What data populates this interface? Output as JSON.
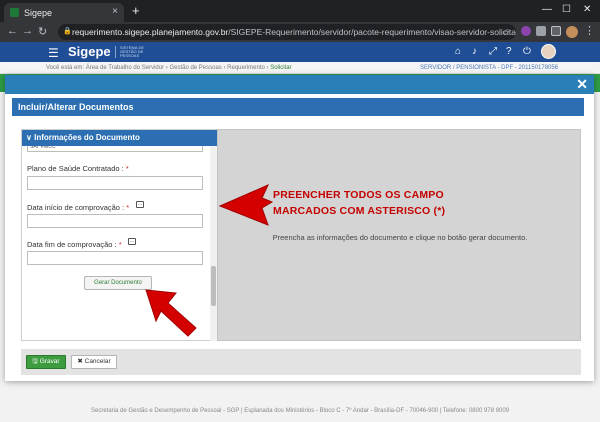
{
  "browser": {
    "tab_title": "Sigepe",
    "tab_close": "×",
    "new_tab": "+",
    "url_host": "requerimento.sigepe.planejamento.gov.br",
    "url_path": "/SIGEPE-Requerimento/servidor/pacote-requerimento/visao-servidor-solicitar.jsf?...",
    "win_minimize": "—",
    "win_maximize": "☐",
    "win_close": "✕"
  },
  "app": {
    "brand": "Sigepe",
    "brand_sub": "SISTEMA DE GESTÃO DE PESSOAS"
  },
  "breadcrumb": {
    "prefix": "Você está em:",
    "items": [
      "Área de Trabalho do Servidor",
      "Gestão de Pessoas",
      "Requerimento"
    ],
    "active": "Solicitar",
    "profile": "SERVIDOR / PENSIONISTA - DPF - 201150178056"
  },
  "modal": {
    "close": "✕",
    "title": "Incluir/Alterar Documentos"
  },
  "document_panel": {
    "header": "Informações do Documento",
    "cut_value": "SAT F/ECC",
    "fields": [
      {
        "label": "Plano de Saúde Contratado :",
        "required": "*"
      },
      {
        "label": "Data início de comprovação :",
        "required": "*"
      },
      {
        "label": "Data fim de comprovação :",
        "required": "*"
      }
    ],
    "generate_button": "Gerar Documento"
  },
  "preview": {
    "message": "Preencha as informações do documento e clique no botão gerar documento."
  },
  "footer_buttons": {
    "save": "Gravar",
    "cancel": "Cancelar"
  },
  "annotation": {
    "line1": "PREENCHER TODOS OS CAMPO",
    "line2": "MARCADOS COM ASTERISCO (*)",
    "color": "#c40000"
  },
  "site_footer": "Secretaria de Gestão e Desempenho de Pessoal - SGP | Esplanada dos Ministérios - Bloco C - 7º Andar - Brasília-DF - 70046-900 | Telefone: 0800 978 9009",
  "colors": {
    "header_blue": "#1f4e96",
    "panel_blue": "#2b6fb2",
    "save_green": "#3d9c3f"
  }
}
